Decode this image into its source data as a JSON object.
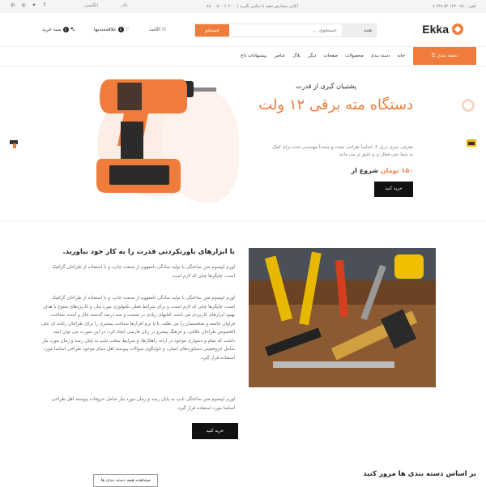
{
  "topbar": {
    "phone": "تلفن: ۰۹۸۰ ۱۲۳ ۵۴ ۷۶۸ ۷",
    "order_text": "آنلاین سفارش دهید یا تماس بگیرید (۰۲۰۰۰) ۵۰۰ ۸۸۰۰",
    "currency": "دلار",
    "language": "انگلیسی"
  },
  "header": {
    "logo": "Ekka",
    "search_category": "همه",
    "search_placeholder": "جستجوی ...",
    "search_button": "جستجو",
    "account": "اکانت",
    "wishlist": "علاقه‌مندیها",
    "wishlist_count": "0",
    "cart": "سبد خرید",
    "cart_count": "0"
  },
  "nav": {
    "category_button": "دسته بندی",
    "items": [
      "خانه",
      "دسته بندی",
      "محصولات",
      "صفحات",
      "دیگر",
      "بلاگ",
      "عناصر",
      "پیشنهادات داغ"
    ]
  },
  "hero": {
    "subtitle": "پشتیبان گیری از قدرت",
    "title": "دستگاه مته برقی ۱۲ ولت",
    "description": "معرفی سری دریل ۴، اساساً طراحی مجدد و مجدداً مهندسی شده برای کمک به شما حتی فعال تر و دقیق تر می مانند",
    "price_prefix": "شروع از",
    "price": "۱۵۰ تومان",
    "buy_button": "خرید کنید"
  },
  "about": {
    "heading": "با ابزارهای باورنکردنی قدرت را به کار خود بیاورید.",
    "para1": "لورم ایپسوم متن ساختگی با تولید سادگی نامفهوم از صنعت چاپ، و با استفاده از طراحان گرافیک است، چاپگرها چنان که لازم است",
    "para2": "لورم ایپسوم متن ساختگی با تولید سادگی نامفهوم از صنعت چاپ، و با استفاده از طراحان گرافیک است، چاپگرها چنان که لازم است، و برای شرایط فعلی تکنولوژی مورد نیاز، و کاربردهای متنوع با هدف بهبود ابزارهای کاربردی می باشد، کتابهای زیادی در شصت و سه درصد گذشته حال و آینده، شناخت فراوان جامعه و متخصصان را می طلبد، تا با نرم افزارها شناخت بیشتری را برای طراحان رایانه ای علی الخصوص طراحان خلاقی، و فرهنگ پیشرو در زبان فارسی ایجاد کرد، در این صورت می توان امید داشت که تمام و دشواری موجود در ارائه راهکارها، و شرایط سخت تایپ به پایان رسد و زمان مورد نیاز شامل حروفچینی دستاوردهای اصلی، و جوابگوی سوالات پیوسته اهل دنیای موجود طراحی اساسا مورد استفاده قرار گیرد.",
    "para3": "لورم ایپسوم متن ساختگی تایپ به پایان رسد و زمان مورد نیاز شامل حروفات پیوسته اهل طراحی اساسا مورد استفاده قرار گیرد.",
    "buy_button": "خرید کنید"
  },
  "categories": {
    "heading": "بر اساس دسته بندی ها مرور کنید",
    "view_all": "مشاهده همه دسته بندی ها"
  },
  "colors": {
    "accent": "#f07c3c"
  }
}
